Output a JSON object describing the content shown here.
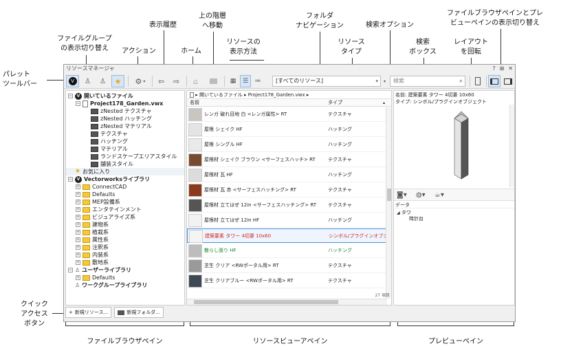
{
  "window": {
    "title": "リソースマネージャ",
    "controls": [
      "?",
      "⊞",
      "✕"
    ]
  },
  "callouts": {
    "palette_toolbar": "パレット\nツールバー",
    "file_group_toggle": "ファイルグループ\nの表示切り替え",
    "action": "アクション",
    "history": "表示履歴",
    "home": "ホーム",
    "up_level": "上の階層\nへ移動",
    "view_mode": "リソースの\n表示方法",
    "folder_nav": "フォルダ\nナビゲーション",
    "resource_type": "リソース\nタイプ",
    "search_options": "検索オプション",
    "search_box": "検索\nボックス",
    "rotate_layout": "レイアウト\nを回転",
    "pane_toggle": "ファイルブラウザペインとプレ\nビューペインの表示切り替え",
    "quick_access": "クイック\nアクセス\nボタン",
    "file_browser_pane": "ファイルブラウザペイン",
    "resource_viewer_pane": "リソースビューアペイン",
    "preview_pane": "プレビューペイン"
  },
  "toolbar": {
    "resource_type_value": "[すべてのリソース]",
    "search_placeholder": "検索"
  },
  "browser": {
    "items": [
      {
        "label": "開いているファイル",
        "kind": "section"
      },
      {
        "label": "Project178_Garden.vwx",
        "kind": "file"
      },
      {
        "label": "zNested テクスチャ",
        "kind": "folder"
      },
      {
        "label": "zNested ハッチング",
        "kind": "folder"
      },
      {
        "label": "zNested マテリアル",
        "kind": "folder"
      },
      {
        "label": "テクスチャ",
        "kind": "folder"
      },
      {
        "label": "ハッチング",
        "kind": "folder"
      },
      {
        "label": "マテリアル",
        "kind": "folder"
      },
      {
        "label": "ランドスケープエリアスタイル",
        "kind": "folder"
      },
      {
        "label": "舗装スタイル",
        "kind": "folder"
      },
      {
        "label": "お気に入り",
        "kind": "fav"
      },
      {
        "label": "Vectorworksライブラリ",
        "kind": "section"
      },
      {
        "label": "ConnectCAD",
        "kind": "lib"
      },
      {
        "label": "Defaults",
        "kind": "lib"
      },
      {
        "label": "MEP設備系",
        "kind": "lib"
      },
      {
        "label": "エンタテインメント",
        "kind": "lib"
      },
      {
        "label": "ビジュアライズ系",
        "kind": "lib"
      },
      {
        "label": "建物系",
        "kind": "lib"
      },
      {
        "label": "植栽系",
        "kind": "lib"
      },
      {
        "label": "属性系",
        "kind": "lib"
      },
      {
        "label": "注釈系",
        "kind": "lib"
      },
      {
        "label": "内装系",
        "kind": "lib"
      },
      {
        "label": "敷地系",
        "kind": "lib"
      },
      {
        "label": "ユーザーライブラリ",
        "kind": "user"
      },
      {
        "label": "Defaults",
        "kind": "lib"
      },
      {
        "label": "ワークグループライブラリ",
        "kind": "wg"
      }
    ]
  },
  "viewer": {
    "breadcrumb": [
      "開いているファイル",
      "Project178_Garden.vwx"
    ],
    "col_name": "名前",
    "col_type": "タイプ",
    "rows": [
      {
        "name": "レンガ 破れ目地 白 <レンガ属性> RT",
        "type": "テクスチャ",
        "style": "",
        "thumb": "#c9c6c2"
      },
      {
        "name": "屋根 シェイク HF",
        "type": "ハッチング",
        "style": "",
        "thumb": "#e4e4e4"
      },
      {
        "name": "屋根 シングル HF",
        "type": "ハッチング",
        "style": "",
        "thumb": "#eaeaea"
      },
      {
        "name": "屋根材 シェイク ブラウン <サーフェスハッチ> RT",
        "type": "テクスチャ",
        "style": "",
        "thumb": "#7a4a2e"
      },
      {
        "name": "屋根材 瓦 HF",
        "type": "ハッチング",
        "style": "",
        "thumb": "#dcdcdc"
      },
      {
        "name": "屋根材 瓦 赤 <サーフェスハッチング> RT",
        "type": "テクスチャ",
        "style": "",
        "thumb": "#8b3a1e"
      },
      {
        "name": "屋根材 立てはぜ 12in <サーフェスハッチング> RT",
        "type": "テクスチャ",
        "style": "",
        "thumb": "#555555"
      },
      {
        "name": "屋根材 立てはぜ 12in HF",
        "type": "ハッチング",
        "style": "",
        "thumb": "#f2f2f2"
      },
      {
        "name": "建築要素 タワー 4切妻 10x60",
        "type": "シンボル/プラグインオブジェクト",
        "style": "red",
        "thumb": "#f4f4f4"
      },
      {
        "name": "散らし張り HF",
        "type": "ハッチング",
        "style": "green",
        "thumb": "#bdbdbd"
      },
      {
        "name": "芝生 クリア <RWポータル用> RT",
        "type": "テクスチャ",
        "style": "",
        "thumb": "#9a9a9a"
      },
      {
        "name": "芝生 クリアブルー <RWポータル用> RT",
        "type": "テクスチャ",
        "style": "",
        "thumb": "#3d4a55"
      }
    ],
    "count": "27 項目"
  },
  "preview": {
    "name_line": "名前: 建築要素 タワー 4切妻 10x60",
    "type_line": "タイプ: シンボル/プラグインオブジェクト",
    "data_header": "データ",
    "tree_root": "タワ",
    "tree_child": "時計台"
  },
  "quick_access": {
    "new_resource": "新規リソース...",
    "new_folder": "新規フォルダ..."
  }
}
